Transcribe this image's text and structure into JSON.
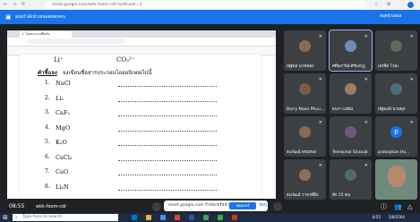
{
  "browser": {
    "url": "meet.google.com/wkk-foom-cdr?authuser=1",
    "nav_icons": [
      "back-arrow-icon",
      "forward-arrow-icon",
      "reload-icon"
    ]
  },
  "banner": {
    "text": "คุณกำลังนำเสนอต่อทุกคน",
    "stop_label": "หยุดนำเสนอ"
  },
  "shared_screen": {
    "tab_title": "1. ไอออน-แบบฝึกหัด",
    "doc": {
      "top_formula_left": "Li⁺",
      "top_formula_right": "CO₃²⁻",
      "instruction_label": "คำชี้แจง",
      "instruction_text": "จงเขียนชื่อสารประกอบไอออนิกต่อไปนี้",
      "items": [
        {
          "num": "1.",
          "formula": "NaCl"
        },
        {
          "num": "2.",
          "formula": "Li₂"
        },
        {
          "num": "3.",
          "formula": "CaF₂"
        },
        {
          "num": "4.",
          "formula": "MgO"
        },
        {
          "num": "5.",
          "formula": "K₂O"
        },
        {
          "num": "6.",
          "formula": "CaCl₂"
        },
        {
          "num": "7.",
          "formula": "CaO"
        },
        {
          "num": "8.",
          "formula": "Li₃N"
        }
      ]
    }
  },
  "participants": [
    {
      "name": "ณัฐพล นาคทอง",
      "avatar_color": "#8e6b4f"
    },
    {
      "name": "ศศิณาวีณ์ ศรีมงกุฎ",
      "avatar_color": "#6b8fb5",
      "active_speaker": true
    },
    {
      "name": "เอรจิต ไวยะ",
      "avatar_color": "#5c6b5a"
    },
    {
      "name": "Barry Nooo Phuu...",
      "avatar_color": "#7a5b4a"
    },
    {
      "name": "ธนวา แซ่ยัง",
      "avatar_color": "#a07c63"
    },
    {
      "name": "ณัฐพงษ์ นวนพุก",
      "avatar_color": "#4b6e7d"
    },
    {
      "name": "ธนวัฒน์ พรมทอง",
      "avatar_color": "#8a6a52"
    },
    {
      "name": "Teerachai Sirasub",
      "avatar_color": "#6f5a7d"
    },
    {
      "name": "prakaykan Ho...",
      "avatar_color": "#1a73e8",
      "initial": "p"
    },
    {
      "name": "ธนวัฒน์ วาจาสี่สิบ",
      "avatar_color": "#8d6e5a"
    },
    {
      "name": "อีก 15 คน",
      "avatar_color": "#4f6a6f"
    },
    {
      "name": "",
      "avatar_color": "#b48a6d",
      "is_self_video": true
    }
  ],
  "meet_bar": {
    "time": "08:55",
    "meeting_code": "wkk-foom-cdr",
    "notice_text": "meet.google.com กำลังแชร์หน้าจอ",
    "notice_stop": "หยุดแชร์",
    "notice_hide": "ซ่อน"
  },
  "taskbar": {
    "search_placeholder": "Type here to search",
    "clock_time": "8:55",
    "clock_date": "2/8/2564"
  }
}
